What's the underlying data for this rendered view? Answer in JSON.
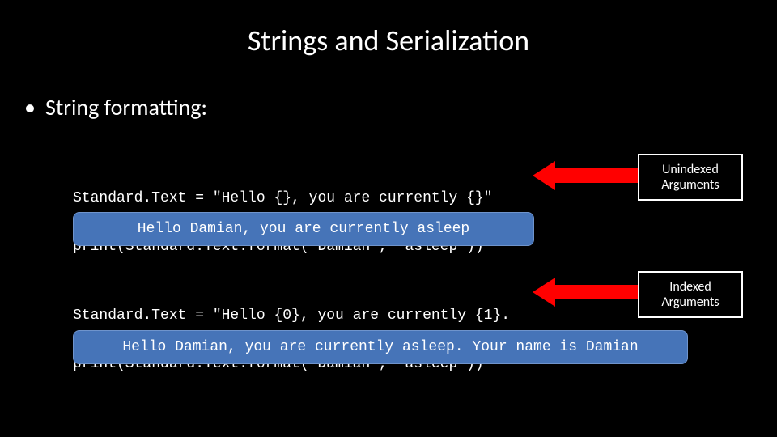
{
  "title": "Strings and Serialization",
  "bullet": "String formatting:",
  "code1_line1": "Standard.Text = \"Hello {}, you are currently {}\"",
  "code1_line2": "print(Standard.Text.format('Damian', 'asleep'))",
  "result1": "Hello Damian, you are currently asleep",
  "label1_line1": "Unindexed",
  "label1_line2": "Arguments",
  "code2_line1": "Standard.Text = \"Hello {0}, you are currently {1}.",
  "code2_line2": "print(Standard.Text.format('Damian', 'asleep'))",
  "result2": "Hello Damian, you are currently asleep. Your name is Damian",
  "label2_line1": "Indexed",
  "label2_line2": "Arguments"
}
